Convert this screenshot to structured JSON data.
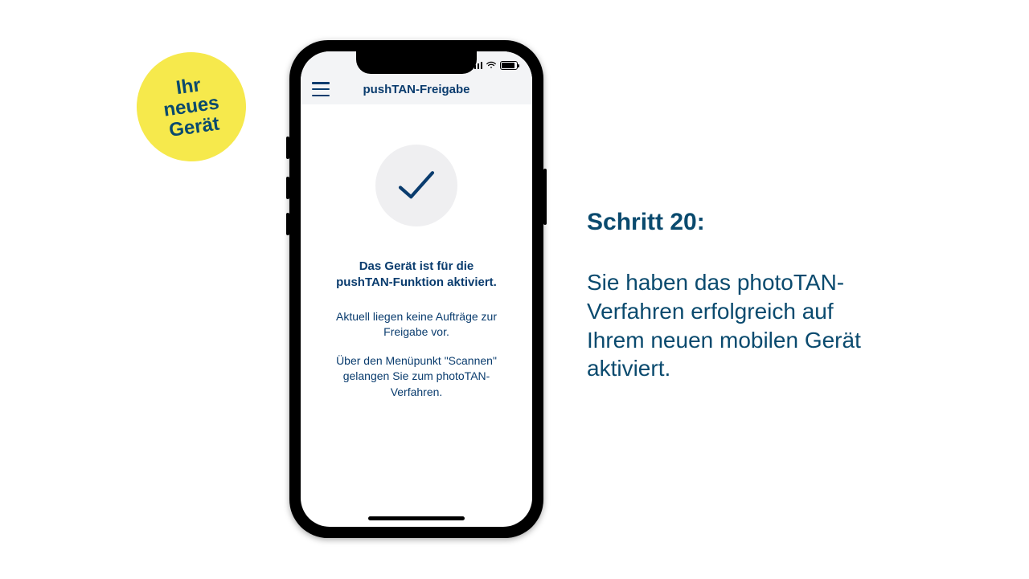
{
  "badge": {
    "line1": "Ihr",
    "line2": "neues",
    "line3": "Gerät"
  },
  "phone": {
    "appbar_title": "pushTAN-Freigabe",
    "confirm": {
      "headline_line1": "Das Gerät ist für die",
      "headline_line2": "pushTAN-Funktion aktiviert.",
      "body1_line1": "Aktuell liegen keine Aufträge zur",
      "body1_line2": "Freigabe vor.",
      "body2_line1": "Über den Menüpunkt \"Scannen\"",
      "body2_line2": "gelangen Sie zum photoTAN-Verfahren."
    }
  },
  "right": {
    "title": "Schritt 20:",
    "body": "Sie haben das photoTAN-Verfahren erfolgreich auf Ihrem neuen mobilen Gerät aktiviert."
  },
  "colors": {
    "accent": "#0a4a6e",
    "badge": "#f6e94c"
  }
}
